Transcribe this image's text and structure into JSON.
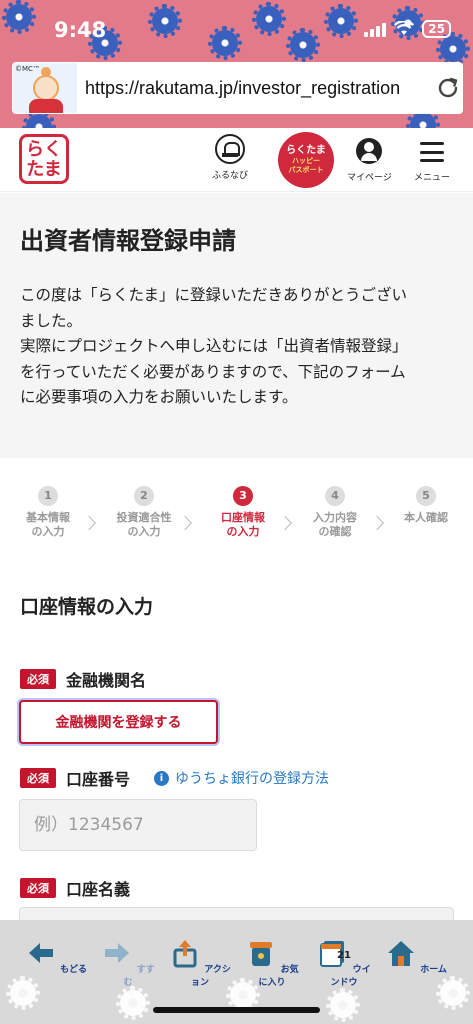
{
  "status_bar": {
    "time": "9:48",
    "battery": "25"
  },
  "browser": {
    "url": "https://rakutama.jp/investor_registration",
    "favicon_mark": "©MC™"
  },
  "header": {
    "logo_line1": "らく",
    "logo_line2": "たま",
    "furunavi_label": "ふるなび",
    "passport_line1": "らくたま",
    "passport_line2": "ハッピー",
    "passport_line3": "パスポート",
    "mypage_label": "マイページ",
    "menu_label": "メニュー"
  },
  "intro": {
    "title": "出資者情報登録申請",
    "line1": "この度は「らくたま」に登録いただきありがとうござい",
    "line2": "ました。",
    "line3": "実際にプロジェクトへ申し込むには「出資者情報登録」",
    "line4": "を行っていただく必要がありますので、下記のフォーム",
    "line5": "に必要事項の入力をお願いいたします。"
  },
  "steps": [
    {
      "num": "1",
      "line1": "基本情報",
      "line2": "の入力",
      "active": false
    },
    {
      "num": "2",
      "line1": "投資適合性",
      "line2": "の入力",
      "active": false
    },
    {
      "num": "3",
      "line1": "口座情報",
      "line2": "の入力",
      "active": true
    },
    {
      "num": "4",
      "line1": "入力内容",
      "line2": "の確認",
      "active": false
    },
    {
      "num": "5",
      "line1": "本人確認",
      "line2": "",
      "active": false
    }
  ],
  "form": {
    "section_title": "口座情報の入力",
    "required_badge": "必須",
    "bank_label": "金融機関名",
    "bank_button": "金融機関を登録する",
    "account_number_label": "口座番号",
    "help_link": "ゆうちょ銀行の登録方法",
    "account_number_placeholder": "例）1234567",
    "account_name_label": "口座名義",
    "account_name_placeholder": ""
  },
  "toolbar": {
    "back": "もどる",
    "forward": "すすむ",
    "action": "アクション",
    "favorites": "お気に入り",
    "window": "ウインドウ",
    "window_count": "21",
    "home": "ホーム"
  },
  "colors": {
    "brand": "#c3152d",
    "link": "#2779c6",
    "status_bg": "#e27a8a"
  }
}
